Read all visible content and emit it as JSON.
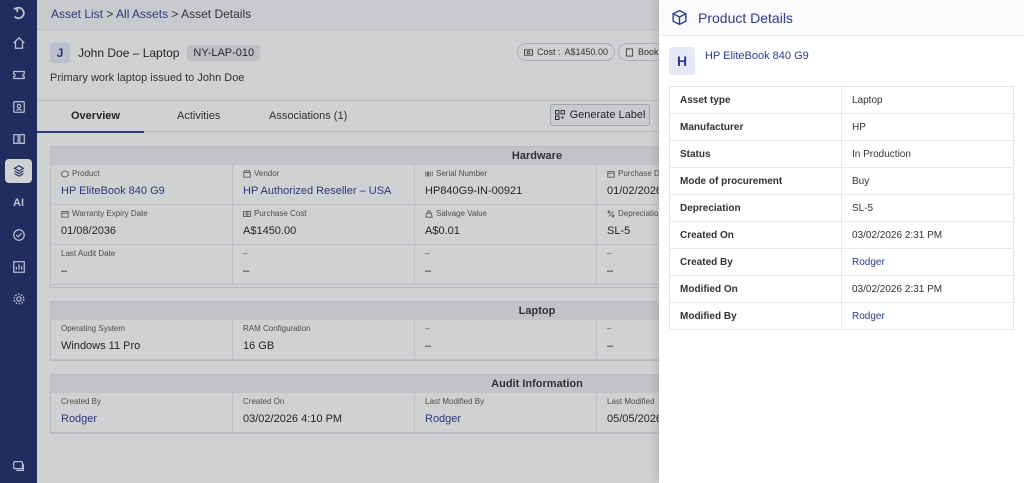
{
  "breadcrumb": {
    "asset_list": "Asset List",
    "sep1": " > ",
    "all_assets": "All Assets",
    "sep2": " > ",
    "current": "Asset Details"
  },
  "asset": {
    "initial": "J",
    "name": "John Doe – Laptop",
    "tag": "NY-LAP-010",
    "description": "Primary work laptop issued to John Doe",
    "cost_label": "Cost :",
    "cost_value": "A$1450.00",
    "book_label": "Book"
  },
  "tabs": [
    "Overview",
    "Activities",
    "Associations (1)"
  ],
  "generate_label_button": "Generate Label",
  "hardware": {
    "title": "Hardware",
    "cells": [
      {
        "label": "Product",
        "value": "HP EliteBook 840 G9",
        "link": true,
        "icon": "cube-icon"
      },
      {
        "label": "Vendor",
        "value": "HP Authorized Reseller – USA",
        "link": true,
        "icon": "store-icon"
      },
      {
        "label": "Serial Number",
        "value": "HP840G9-IN-00921",
        "link": false,
        "icon": "barcode-icon"
      },
      {
        "label": "Purchase D",
        "value": "01/02/2026",
        "link": false,
        "icon": "calendar-icon"
      },
      {
        "label": "Warranty Expiry Date",
        "value": "01/08/2036",
        "link": false,
        "icon": "calendar-icon"
      },
      {
        "label": "Purchase Cost",
        "value": "A$1450.00",
        "link": false,
        "icon": "money-icon"
      },
      {
        "label": "Salvage Value",
        "value": "A$0.01",
        "link": false,
        "icon": "bag-icon"
      },
      {
        "label": "Depreciatio",
        "value": "SL-5",
        "link": false,
        "icon": "percent-icon"
      },
      {
        "label": "Last Audit Date",
        "value": "–",
        "link": false,
        "icon": ""
      },
      {
        "label": "–",
        "value": "–",
        "link": false,
        "icon": ""
      },
      {
        "label": "–",
        "value": "–",
        "link": false,
        "icon": ""
      },
      {
        "label": "–",
        "value": "–",
        "link": false,
        "icon": ""
      }
    ]
  },
  "laptop": {
    "title": "Laptop",
    "cells": [
      {
        "label": "Operating System",
        "value": "Windows 11 Pro",
        "link": false
      },
      {
        "label": "RAM Configuration",
        "value": "16 GB",
        "link": false
      },
      {
        "label": "–",
        "value": "–",
        "link": false
      },
      {
        "label": "–",
        "value": "–",
        "link": false
      }
    ]
  },
  "audit": {
    "title": "Audit Information",
    "cells": [
      {
        "label": "Created By",
        "value": "Rodger",
        "link": true
      },
      {
        "label": "Created On",
        "value": "03/02/2026 4:10 PM",
        "link": false
      },
      {
        "label": "Last Modified By",
        "value": "Rodger",
        "link": true
      },
      {
        "label": "Last Modified",
        "value": "05/05/2026",
        "link": false
      }
    ]
  },
  "drawer": {
    "title": "Product Details",
    "product_initial": "H",
    "product_name": "HP EliteBook 840 G9",
    "rows": [
      {
        "key": "Asset type",
        "value": "Laptop",
        "link": false
      },
      {
        "key": "Manufacturer",
        "value": "HP",
        "link": false
      },
      {
        "key": "Status",
        "value": "In Production",
        "link": false
      },
      {
        "key": "Mode of procurement",
        "value": "Buy",
        "link": false
      },
      {
        "key": "Depreciation",
        "value": "SL-5",
        "link": false
      },
      {
        "key": "Created On",
        "value": "03/02/2026 2:31 PM",
        "link": false
      },
      {
        "key": "Created By",
        "value": "Rodger",
        "link": true
      },
      {
        "key": "Modified On",
        "value": "03/02/2026 2:31 PM",
        "link": false
      },
      {
        "key": "Modified By",
        "value": "Rodger",
        "link": true
      }
    ]
  },
  "nav": {
    "items": [
      "logo-icon",
      "home-icon",
      "ticket-icon",
      "contacts-icon",
      "book-icon",
      "assets-icon",
      "ai-icon",
      "check-icon",
      "chart-icon",
      "settings-icon"
    ],
    "ai_text": "AI",
    "bottom": "chat-icon"
  },
  "colors": {
    "rail": "#1f2d6b",
    "accent": "#2d3b8e"
  }
}
